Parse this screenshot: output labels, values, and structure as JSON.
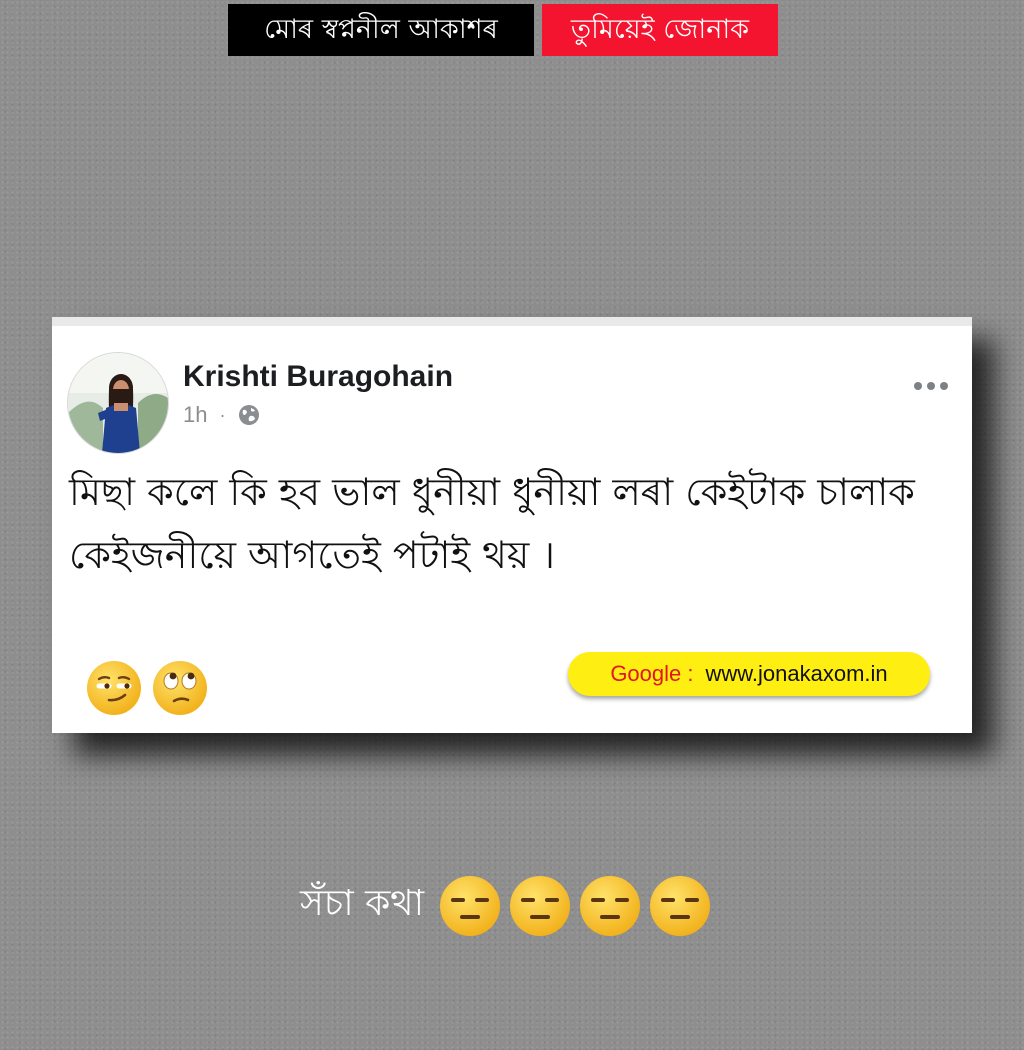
{
  "banner": {
    "part1": "মোৰ স্বপ্ননীল আকাশৰ",
    "part2": "তুমিয়েই জোনাক",
    "part1_bg": "#000000",
    "part2_bg": "#f4142f"
  },
  "post": {
    "author": "Krishti Buragohain",
    "time": "1h",
    "separator": "·",
    "privacy_icon": "globe-icon",
    "menu_icon": "more-options-icon",
    "text": "মিছা কলে কি হব ভাল ধুনীয়া ধুনীয়া লৰা কেইটাক চালাক কেইজনীয়ে আগতেই পটাই থয় ।",
    "emojis": [
      "smirking-face-emoji",
      "face-with-rolling-eyes-emoji"
    ],
    "watermark": {
      "label": "Google :",
      "url": "www.jonakaxom.in",
      "bg": "#ffee12",
      "label_color": "#e0171f"
    }
  },
  "caption": {
    "text": "সঁচা কথা",
    "emojis": [
      "expressionless-face-emoji",
      "expressionless-face-emoji",
      "expressionless-face-emoji",
      "expressionless-face-emoji"
    ]
  },
  "colors": {
    "background": "#8e8e8e",
    "card": "#ffffff",
    "emoji_yellow": "#fbc531"
  }
}
